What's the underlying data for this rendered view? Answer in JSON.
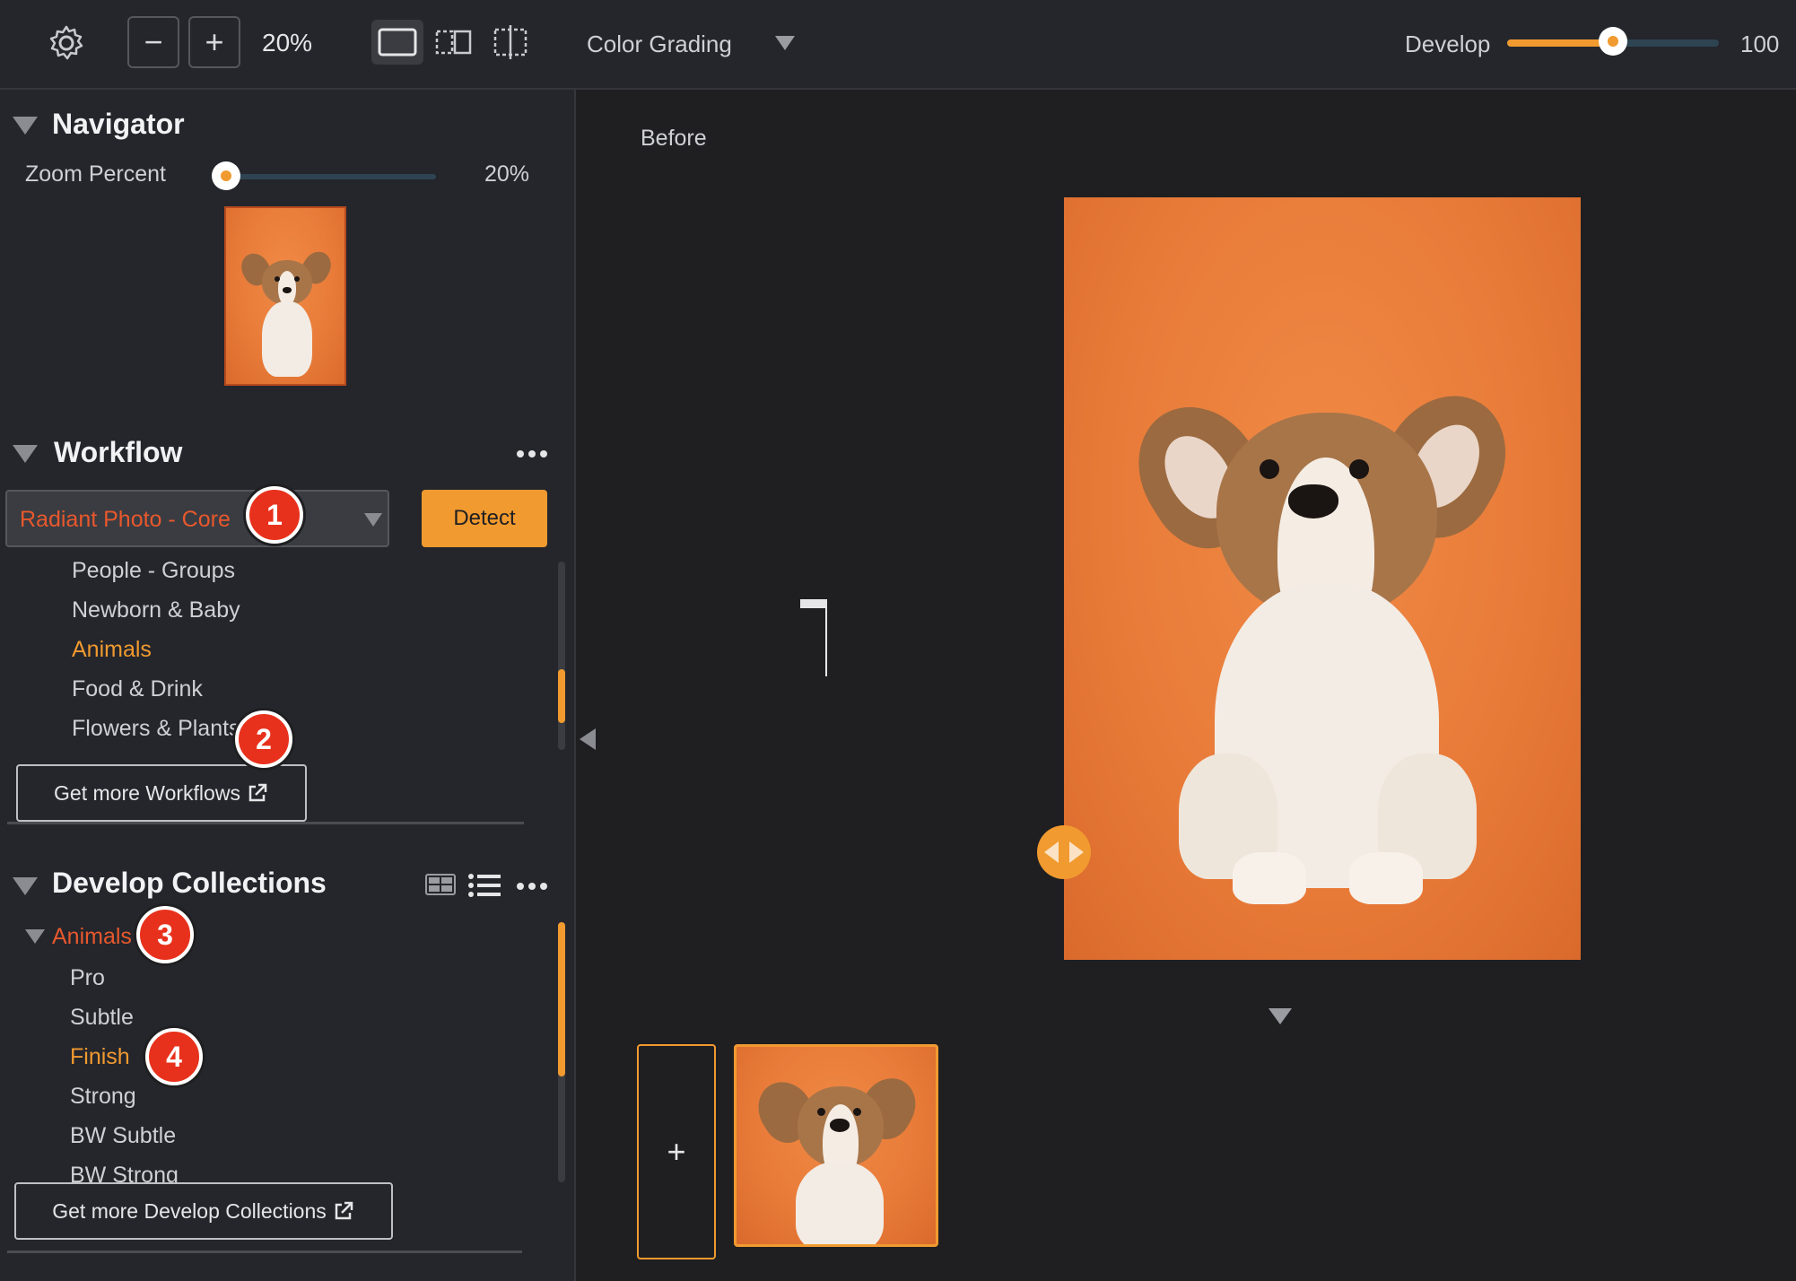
{
  "toolbar": {
    "zoom_value": "20%",
    "mode_label": "Color Grading",
    "develop_label": "Develop",
    "develop_value": "100",
    "develop_level": 0.5
  },
  "navigator": {
    "title": "Navigator",
    "zoom_label": "Zoom Percent",
    "zoom_value": "20%",
    "zoom_level": 0.0
  },
  "workflow": {
    "title": "Workflow",
    "selected": "Radiant Photo - Core",
    "detect_label": "Detect",
    "items": [
      {
        "label": "People - Groups",
        "active": false
      },
      {
        "label": "Newborn & Baby",
        "active": false
      },
      {
        "label": "Animals",
        "active": true
      },
      {
        "label": "Food & Drink",
        "active": false
      },
      {
        "label": "Flowers & Plants",
        "active": false
      }
    ],
    "more_label": "Get more Workflows"
  },
  "collections": {
    "title": "Develop Collections",
    "group": "Animals",
    "items": [
      {
        "label": "Pro",
        "active": false
      },
      {
        "label": "Subtle",
        "active": false
      },
      {
        "label": "Finish",
        "active": true
      },
      {
        "label": "Strong",
        "active": false
      },
      {
        "label": "BW Subtle",
        "active": false
      },
      {
        "label": "BW Strong",
        "active": false
      }
    ],
    "more_label": "Get more Develop Collections"
  },
  "badges": [
    "1",
    "2",
    "3",
    "4"
  ],
  "canvas": {
    "before_label": "Before",
    "add_label": "+"
  },
  "colors": {
    "accent": "#f19a2f",
    "badge": "#e8311c",
    "background": "#1f1f22",
    "panel": "#24262c"
  },
  "icons": [
    "gear-icon",
    "minus-icon",
    "plus-icon",
    "single-view-icon",
    "split-view-icon",
    "crop-view-icon",
    "chevron-down-icon",
    "grid-view-icon",
    "list-view-icon",
    "more-icon",
    "external-link-icon",
    "compare-handle-icon",
    "collapse-left-icon"
  ]
}
